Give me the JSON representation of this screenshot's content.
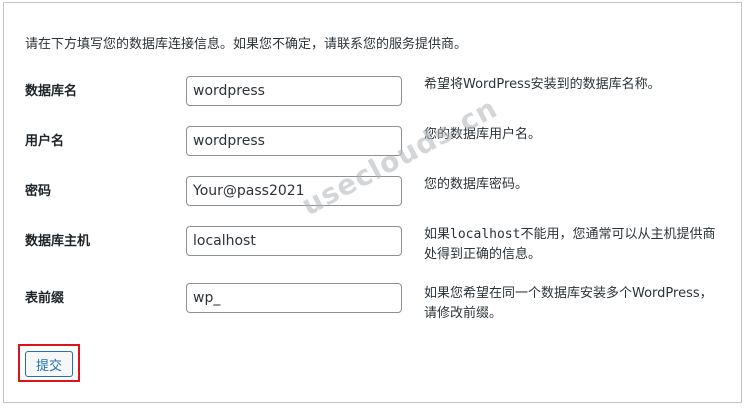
{
  "intro": "请在下方填写您的数据库连接信息。如果您不确定，请联系您的服务提供商。",
  "fields": [
    {
      "label": "数据库名",
      "value": "wordpress",
      "desc": "希望将WordPress安装到的数据库名称。"
    },
    {
      "label": "用户名",
      "value": "wordpress",
      "desc": "您的数据库用户名。"
    },
    {
      "label": "密码",
      "value": "Your@pass2021",
      "desc": "您的数据库密码。"
    },
    {
      "label": "数据库主机",
      "value": "localhost",
      "desc_prefix": "如果",
      "desc_code": "localhost",
      "desc_suffix": "不能用，您通常可以从主机提供商处得到正确的信息。"
    },
    {
      "label": "表前缀",
      "value": "wp_",
      "desc": "如果您希望在同一个数据库安装多个WordPress，请修改前缀。"
    }
  ],
  "submit_label": "提交",
  "watermark": "useclouds.cn"
}
